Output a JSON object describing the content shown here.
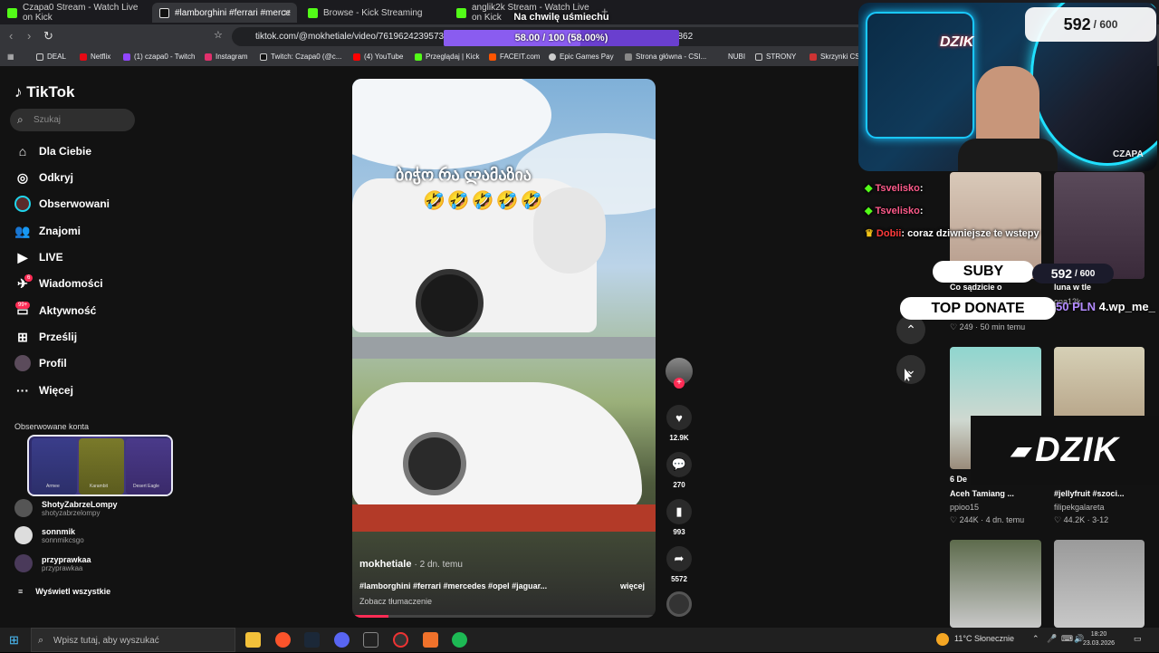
{
  "browser": {
    "tabs": [
      {
        "title": "Czapa0 Stream - Watch Live on Kick",
        "color": "#53fc18"
      },
      {
        "title": "#lamborghini #ferrari #merce",
        "color": "#000000"
      },
      {
        "title": "Browse - Kick Streaming",
        "color": "#53fc18"
      },
      {
        "title": "anglik2k Stream - Watch Live on Kick",
        "color": "#53fc18"
      }
    ],
    "url": "tiktok.com/@mokhetiale/video/761962423957399",
    "url_tail": "83837539862",
    "bookmarks": [
      "DEAL",
      "Netflix",
      "(1) czapa0 - Twitch",
      "Instagram",
      "Twitch: Czapa0 (@c...",
      "(4) YouTube",
      "Przeglądaj | Kick",
      "FACEIT.com",
      "Epic Games Pay",
      "Strona główna - CSI...",
      "NUBI",
      "STRONY",
      "Skrzynki CS..."
    ]
  },
  "sidebar": {
    "logo": "TikTok",
    "search_placeholder": "Szukaj",
    "nav": [
      "Dla Ciebie",
      "Odkryj",
      "Obserwowani",
      "Znajomi",
      "LIVE",
      "Wiadomości",
      "Aktywność",
      "Prześlij",
      "Profil",
      "Więcej"
    ],
    "badges": {
      "messages": "6",
      "activity": "99+"
    },
    "followed_title": "Obserwowane konta",
    "accounts": [
      {
        "name": "ShotyZabrzeLompy",
        "handle": "shotyzabrzelompy"
      },
      {
        "name": "sonnmik",
        "handle": "sonnmikcsgo"
      },
      {
        "name": "przyprawkaa",
        "handle": "przyprawkaa"
      }
    ],
    "show_all": "Wyświetl wszystkie"
  },
  "overlay_card": {
    "labels": [
      "Armee",
      "Karambit",
      "Desert Eagle"
    ]
  },
  "video": {
    "overlay_text": "ბიჭო რა ლამაზია",
    "emojis": "🤣🤣🤣🤣🤣",
    "author": "mokhetiale",
    "time": "· 2 dn. temu",
    "tags": "#lamborghini #ferrari #mercedes #opel #jaguar...",
    "more": "więcej",
    "translate": "Zobacz tłumaczenie",
    "progress": 0.12
  },
  "actions": {
    "likes": "12.9K",
    "comments": "270",
    "saves": "993",
    "shares": "5572"
  },
  "stream_overlay": {
    "goal_title": "Na chwilę uśmiechu",
    "goal_label": "58.00 / 100 (58.00%)",
    "goal_progress": 0.58,
    "counter_value": "592",
    "counter_max": "/ 600",
    "streamer_tag": "CZAPA",
    "brand_small": "DZIK",
    "brand_big": "DZIK",
    "chat": [
      {
        "user": "Tsvelisko",
        "msg": ":"
      },
      {
        "user": "Tsvelisko",
        "msg": ":"
      },
      {
        "user": "Dobii",
        "msg": ": coraz dziwniejsze te wstepy"
      }
    ],
    "subs_label": "SUBY",
    "subs_value": "592",
    "subs_max": "/ 600",
    "top_donate_label": "TOP DONATE",
    "top_donate_value": "50 PLN",
    "top_donate_user": "4.wp_me_"
  },
  "right_grid": {
    "items": [
      {
        "caption": "Co sądzicie o",
        "user": "",
        "meta": "249 · 50 min temu"
      },
      {
        "caption": "luna w tle",
        "user": "ona13k",
        "meta": ""
      },
      {
        "caption": "6 De",
        "caption2": "Aceh Tamiang ...",
        "user": "ppioo15",
        "meta": "244K · 4 dn. temu"
      },
      {
        "caption": "#jellyfruit #szoci...",
        "user": "filipekgalareta",
        "meta": "44.2K · 3-12"
      }
    ]
  },
  "taskbar": {
    "search_placeholder": "Wpisz tutaj, aby wyszukać",
    "weather": "11°C Słonecznie",
    "time": "18:20",
    "date": "23.03.2026"
  }
}
